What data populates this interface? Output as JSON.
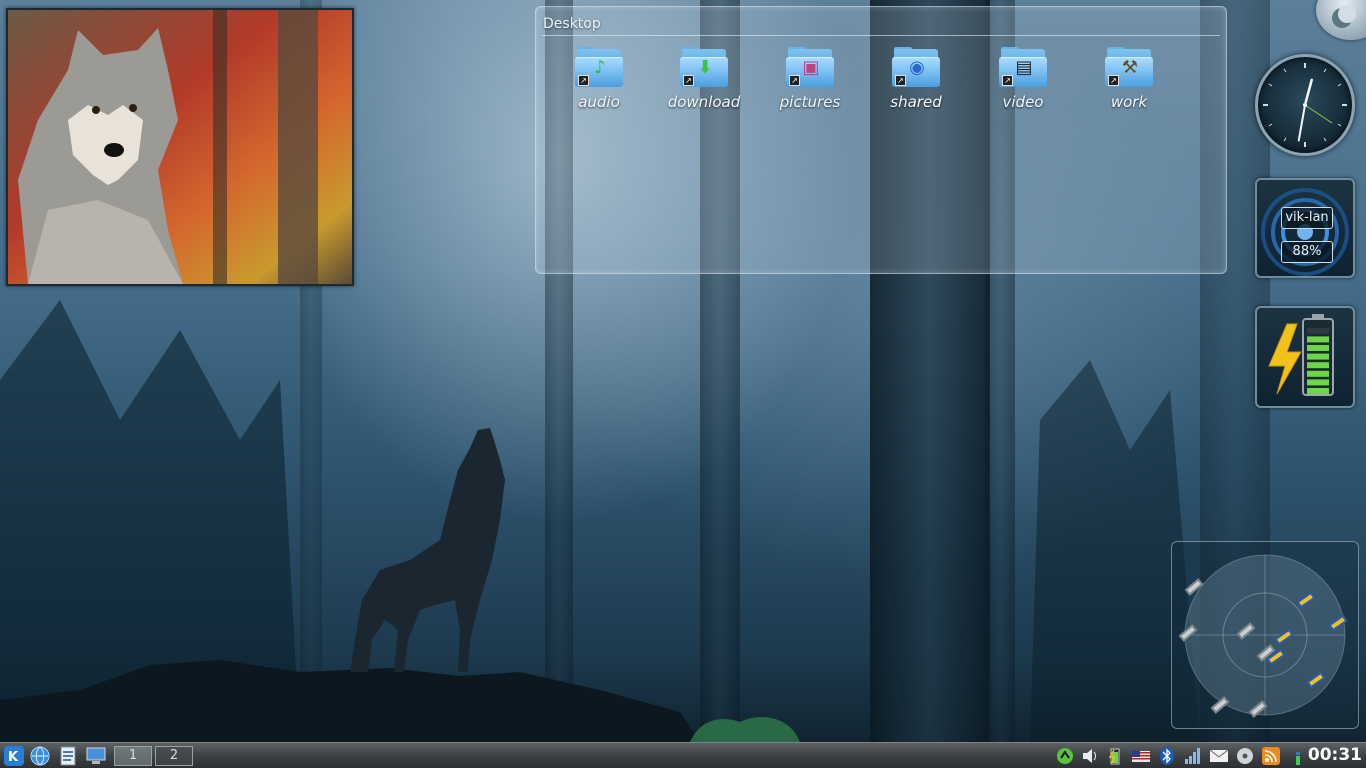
{
  "wallpaper": {
    "subject": "wolf-howling-in-misty-forest"
  },
  "photo_frame": {
    "subject": "gray-wolf-in-autumn-forest"
  },
  "folderview": {
    "title": "Desktop",
    "items": [
      {
        "label": "audio",
        "icon": "music-note-icon",
        "color": "#2fbf3a"
      },
      {
        "label": "download",
        "icon": "download-arrow-icon",
        "color": "#3cc43c"
      },
      {
        "label": "pictures",
        "icon": "picture-icon",
        "color": "#c04080"
      },
      {
        "label": "shared",
        "icon": "globe-icon",
        "color": "#2a6ad0"
      },
      {
        "label": "video",
        "icon": "clapperboard-icon",
        "color": "#333333"
      },
      {
        "label": "work",
        "icon": "hammer-icon",
        "color": "#8a6a3a"
      }
    ]
  },
  "clock_widget": {
    "hour_hand_deg": 15,
    "minute_hand_deg": 190
  },
  "network_widget": {
    "name": "vik-lan",
    "signal": "88%"
  },
  "battery_widget": {
    "charging": true,
    "level": 0.9,
    "color": "#6fd64a"
  },
  "taskbar": {
    "pager": [
      "1",
      "2"
    ],
    "active_desktop": "1",
    "clock": "00:31",
    "tray": [
      "network-manager-icon",
      "volume-icon",
      "battery-icon",
      "keyboard-layout-icon",
      "bluetooth-icon",
      "signal-strength-icon",
      "mail-icon",
      "disk-icon",
      "rss-icon",
      "system-monitor-icon"
    ]
  }
}
